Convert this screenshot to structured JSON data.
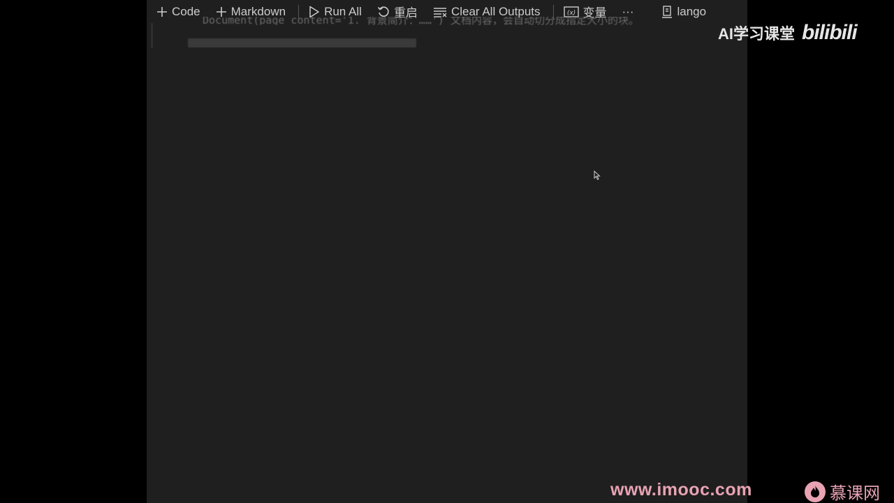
{
  "toolbar": {
    "add_code_label": "Code",
    "add_markdown_label": "Markdown",
    "run_all_label": "Run All",
    "restart_label": "重启",
    "clear_outputs_label": "Clear All Outputs",
    "variables_label": "变量",
    "more_label": "···",
    "kernel_label": "lango"
  },
  "editor": {
    "code_line": "Document(page_content='1. 背景简介：……') 文档内容，会自动切分成指定大小的块。",
    "background_color": "#1f1f1f"
  },
  "watermarks": {
    "brand_text": "AI学习课堂",
    "bili_text": "bilibili",
    "site_url": "www.imooc.com",
    "site_name": "慕课网",
    "accent_color": "#e8a3b3"
  },
  "icons": {
    "add": "plus-icon",
    "run": "play-icon",
    "restart": "restart-icon",
    "clear": "clear-outputs-icon",
    "variables": "variables-icon",
    "kernel": "kernel-icon",
    "pointer": "mouse-pointer-icon"
  }
}
